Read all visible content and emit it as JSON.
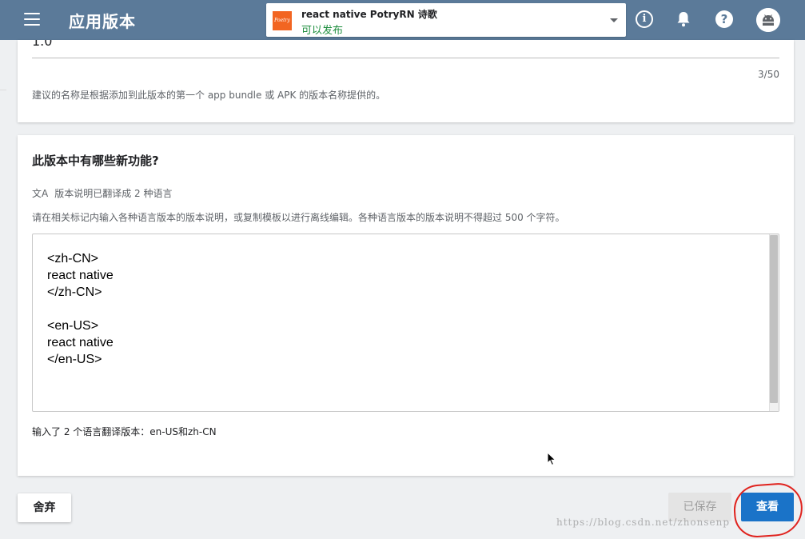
{
  "header": {
    "menu_icon": "hamburger-menu-icon",
    "title": "应用版本",
    "app": {
      "logo_text": "Poetry",
      "name": "react native PotryRN 诗歌",
      "status": "可以发布",
      "status_color": "#1e8e3e"
    },
    "icons": [
      "info-icon",
      "bell-icon",
      "help-icon",
      "avatar-icon"
    ],
    "info_glyph": "i",
    "help_glyph": "?"
  },
  "release_name": {
    "value_partial": "1.0",
    "char_count": "3/50",
    "hint": "建议的名称是根据添加到此版本的第一个 app bundle 或 APK 的版本名称提供的。"
  },
  "release_notes": {
    "title": "此版本中有哪些新功能?",
    "translate_icon": "文A",
    "translate_status": "版本说明已翻译成 2 种语言",
    "hint": "请在相关标记内输入各种语言版本的版本说明，或复制模板以进行离线编辑。各种语言版本的版本说明不得超过 500 个字符。",
    "content": "<zh-CN>\nreact native\n</zh-CN>\n\n<en-US>\nreact native\n</en-US>",
    "summary": "输入了 2 个语言翻译版本：en-US和zh-CN"
  },
  "footer": {
    "discard_label": "舍弃",
    "saved_label": "已保存",
    "review_label": "查看",
    "primary_color": "#1a73c8"
  },
  "watermark": "https://blog.csdn.net/zhonsenp"
}
